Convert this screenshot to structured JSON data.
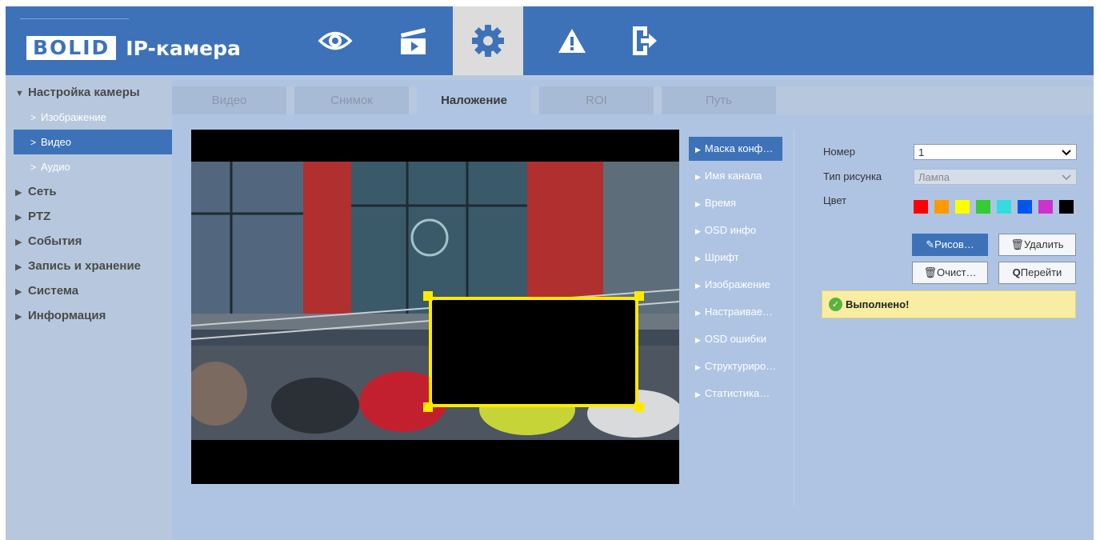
{
  "header": {
    "logo": "BOLID",
    "app_title": "IP-камера",
    "nav": [
      {
        "icon": "eye-icon",
        "label": "Просмотр"
      },
      {
        "icon": "playback-icon",
        "label": "Воспроизведение"
      },
      {
        "icon": "gear-icon",
        "label": "Настройки",
        "active": true
      },
      {
        "icon": "alarm-icon",
        "label": "Тревога"
      },
      {
        "icon": "logout-icon",
        "label": "Выход"
      }
    ]
  },
  "sidebar": {
    "camera_settings": "Настройка камеры",
    "sub_items": [
      "Изображение",
      "Видео",
      "Аудио"
    ],
    "active_sub": "Видео",
    "groups": [
      "Сеть",
      "PTZ",
      "События",
      "Запись и хранение",
      "Система",
      "Информация"
    ]
  },
  "tabs": [
    "Видео",
    "Снимок",
    "Наложение",
    "ROI",
    "Путь"
  ],
  "active_tab": "Наложение",
  "overlay_menu": [
    "Маска конф…",
    "Имя канала",
    "Время",
    "OSD инфо",
    "Шрифт",
    "Изображение",
    "Настраивае…",
    "OSD ошибки",
    "Структуриро…",
    "Статистика…"
  ],
  "form": {
    "number_label": "Номер",
    "number_value": "1",
    "shape_type_label": "Тип рисунка",
    "shape_type_value": "Лампа",
    "color_label": "Цвет",
    "colors": [
      "#ff0000",
      "#ff9900",
      "#ffff00",
      "#33cc33",
      "#33dddd",
      "#0055ee",
      "#cc33cc",
      "#000000"
    ],
    "draw_button": "Рисов…",
    "delete_button": "Удалить",
    "clear_button": "Очист…",
    "goto_button": "Перейти"
  },
  "status": {
    "message": "Выполнено!"
  },
  "colors": {
    "accent": "#3d72b9",
    "mask_border": "#ffea00"
  }
}
